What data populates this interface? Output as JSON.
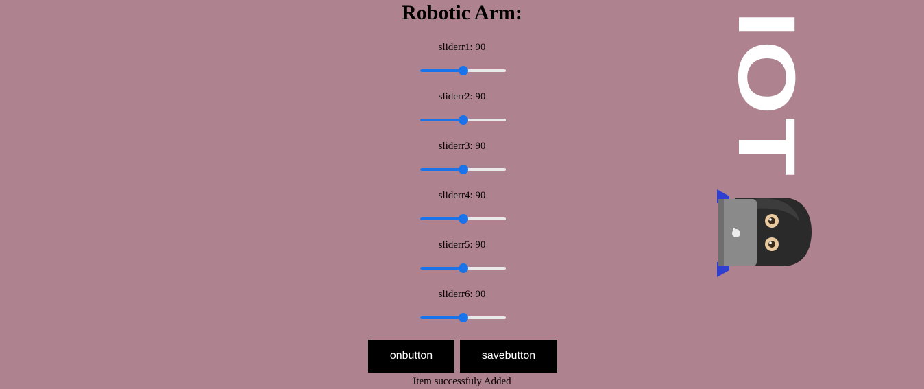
{
  "page": {
    "title": "Robotic Arm:",
    "sliders": [
      {
        "label": "sliderr1: 90",
        "value": 90,
        "min": 0,
        "max": 180
      },
      {
        "label": "sliderr2: 90",
        "value": 90,
        "min": 0,
        "max": 180
      },
      {
        "label": "sliderr3: 90",
        "value": 90,
        "min": 0,
        "max": 180
      },
      {
        "label": "sliderr4: 90",
        "value": 90,
        "min": 0,
        "max": 180
      },
      {
        "label": "sliderr5: 90",
        "value": 90,
        "min": 0,
        "max": 180
      },
      {
        "label": "sliderr6: 90",
        "value": 90,
        "min": 0,
        "max": 180
      }
    ],
    "buttons": {
      "on_label": "onbutton",
      "save_label": "savebutton"
    },
    "status": "Item successfuly Added"
  },
  "logo": {
    "text": "IOT"
  },
  "colors": {
    "background": "#ae828e",
    "slider_accent": "#1a73e8",
    "button_bg": "#000000",
    "button_text": "#ffffff"
  }
}
